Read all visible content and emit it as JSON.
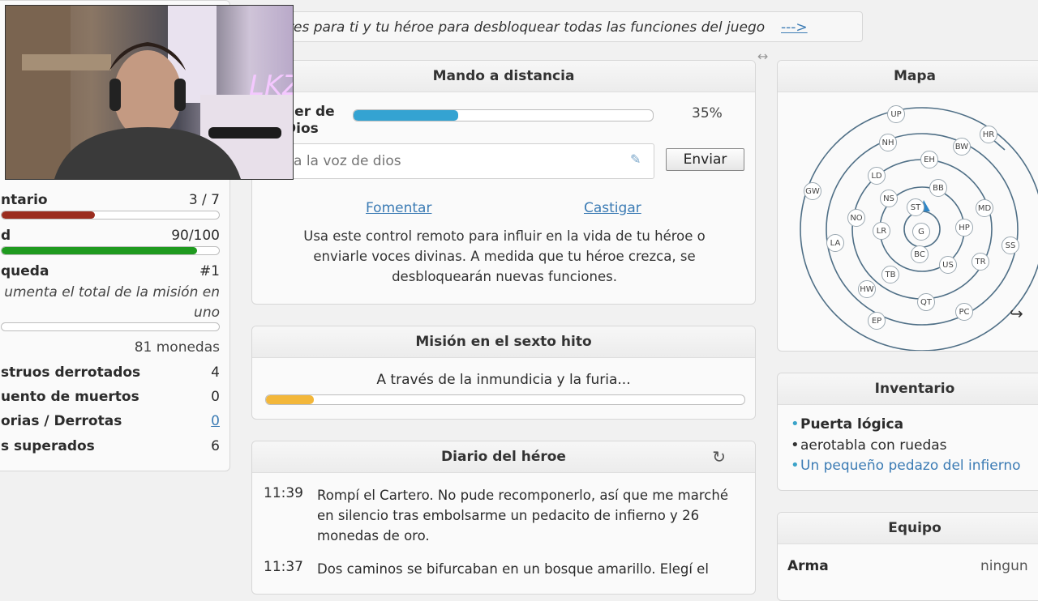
{
  "banner": {
    "text": "res para ti y tu héroe para desbloquear todas las funciones del juego",
    "link": "--->"
  },
  "resize_icon": "↔",
  "left_panel": {
    "rows": [
      {
        "label": "ntario",
        "value": "3 / 7"
      },
      {
        "label": "d",
        "value": "90/100"
      },
      {
        "label": "queda",
        "value": "#1"
      }
    ],
    "quest_note": "umenta el total de la misión en uno",
    "coins": "81 monedas",
    "stats": [
      {
        "label": "struos derrotados",
        "value": "4"
      },
      {
        "label": "uento de muertos",
        "value": "0"
      },
      {
        "label": "orias / Derrotas",
        "value": "0"
      },
      {
        "label": "s superados",
        "value": "6"
      }
    ],
    "bars": {
      "inventory": {
        "fraction": 0.43,
        "color": "#9b2d1f"
      },
      "health": {
        "fraction": 0.9,
        "color": "#1f9a1f"
      },
      "quest": {
        "fraction": 0.0,
        "color": "#f0b132"
      }
    }
  },
  "remote": {
    "title": "Mando a distancia",
    "godpower_label": "der de Dios",
    "godpower_percent": "35%",
    "godpower_value": 0.35,
    "voice_placeholder": "a la voz de dios",
    "send_label": "Enviar",
    "encourage": "Fomentar",
    "punish": "Castigar",
    "description": "Usa este control remoto para influir en la vida de tu héroe o enviarle voces divinas. A medida que tu héroe crezca, se desbloquearán nuevas funciones."
  },
  "quest": {
    "title": "Misión en el sexto hito",
    "name": "A través de la inmundicia y la furia...",
    "progress": 0.1
  },
  "diary": {
    "title": "Diario del héroe",
    "refresh_icon": "↻",
    "entries": [
      {
        "time": "11:39",
        "text": "Rompí el Cartero. No pude recomponerlo, así que me marché en silencio tras embolsarme un pedacito de infierno y 26 monedas de oro."
      },
      {
        "time": "11:37",
        "text": "Dos caminos se bifurcaban en un bosque amarillo. Elegí el"
      }
    ]
  },
  "map": {
    "title": "Mapa",
    "nodes": [
      "UP",
      "HR",
      "NH",
      "BW",
      "EH",
      "LD",
      "BB",
      "GW",
      "NS",
      "MD",
      "NO",
      "ST",
      "LR",
      "G",
      "HP",
      "LA",
      "SS",
      "BC",
      "TR",
      "US",
      "TB",
      "HW",
      "QT",
      "PC",
      "EP"
    ],
    "arrow_icon": "↪"
  },
  "inventory": {
    "title": "Inventario",
    "items": [
      {
        "text": "Puerta lógica",
        "bold": true,
        "color": "#3ba3c9"
      },
      {
        "text": "aerotabla con ruedas",
        "bold": false,
        "color": "#333333"
      },
      {
        "text": "Un pequeño pedazo del infierno",
        "bold": false,
        "color": "#3ba3c9"
      }
    ]
  },
  "equipment": {
    "title": "Equipo",
    "weapon_label": "Arma",
    "weapon_value": "ningun"
  }
}
